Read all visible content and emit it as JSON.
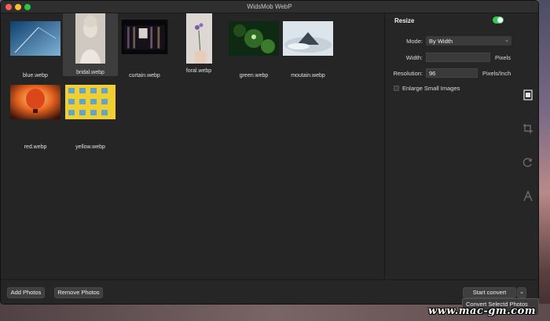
{
  "window": {
    "title": "WidsMob WebP"
  },
  "photos": [
    {
      "name": "blue.webp",
      "colors": [
        "#1c5a8c",
        "#6ea3c8"
      ]
    },
    {
      "name": "bridal.webp",
      "colors": [
        "#b7b3ad",
        "#e7e1d8"
      ]
    },
    {
      "name": "curtain.webp",
      "colors": [
        "#0c0c12",
        "#4a3b52"
      ]
    },
    {
      "name": "foral.webp",
      "colors": [
        "#dcd6d3",
        "#b6a8bf"
      ]
    },
    {
      "name": "green.webp",
      "colors": [
        "#0d2a10",
        "#3f7a2e"
      ]
    },
    {
      "name": "moutain.webp",
      "colors": [
        "#c9d6e0",
        "#7c8a96"
      ]
    },
    {
      "name": "red.webp",
      "colors": [
        "#f08a2a",
        "#4d1a10"
      ]
    },
    {
      "name": "yellow.webp",
      "colors": [
        "#f2d23b",
        "#b89a1e"
      ]
    }
  ],
  "resize": {
    "title": "Resize",
    "enabled": true,
    "mode_label": "Mode:",
    "mode_value": "By Width",
    "width_label": "Width:",
    "width_value": "",
    "width_unit": "Pixels",
    "resolution_label": "Resolution:",
    "resolution_value": "96",
    "resolution_unit": "Pixels/Inch",
    "enlarge_label": "Enlarge Small Images"
  },
  "toolbar": {
    "add_label": "Add Photos",
    "remove_label": "Remove Photos",
    "start_label": "Start convert",
    "menu_item": "Convert Selectd Photos"
  },
  "watermark": "www.mac-gm.com"
}
